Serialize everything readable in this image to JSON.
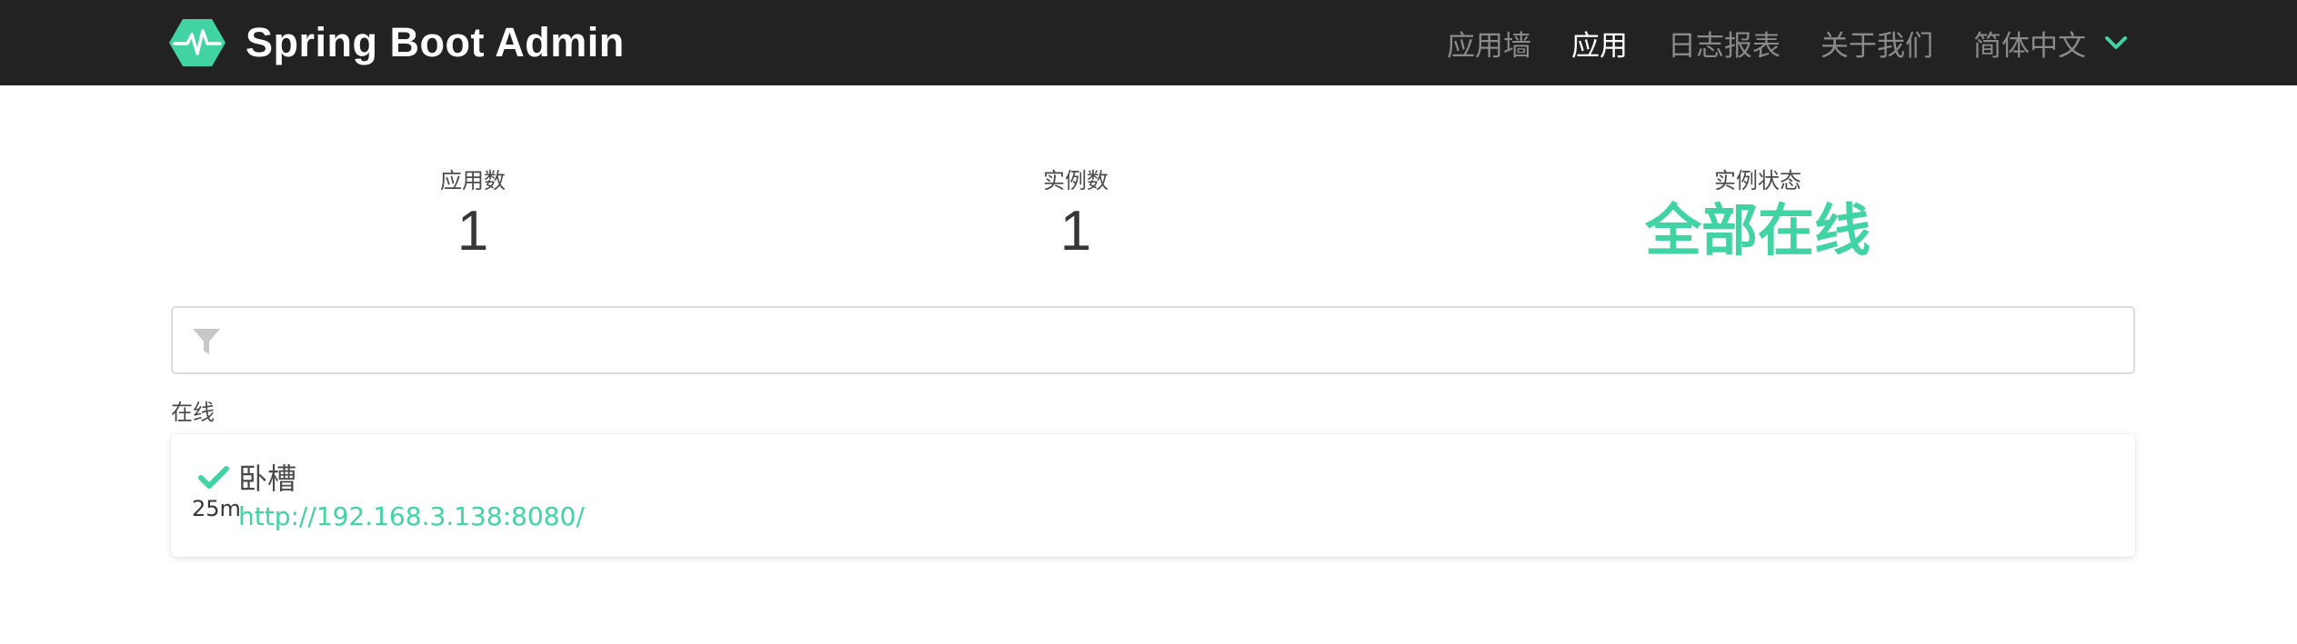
{
  "navbar": {
    "brand_title": "Spring Boot Admin",
    "brand_icon": "heartbeat-logo-icon",
    "items": [
      {
        "label": "应用墙",
        "active": false
      },
      {
        "label": "应用",
        "active": true
      },
      {
        "label": "日志报表",
        "active": false
      },
      {
        "label": "关于我们",
        "active": false
      }
    ],
    "language": "简体中文",
    "language_icon": "chevron-down-icon"
  },
  "stats": {
    "apps_label": "应用数",
    "apps_value": "1",
    "instances_label": "实例数",
    "instances_value": "1",
    "status_label": "实例状态",
    "status_value": "全部在线"
  },
  "filter": {
    "icon": "filter-icon",
    "value": "",
    "placeholder": ""
  },
  "group": {
    "label": "在线",
    "apps": [
      {
        "status_icon": "check-icon",
        "uptime": "25m",
        "name": "卧槽",
        "url": "http://192.168.3.138:8080/"
      }
    ]
  },
  "colors": {
    "navbar_bg": "#222222",
    "accent": "#42d3a5",
    "nav_inactive": "#8a8a8a"
  }
}
